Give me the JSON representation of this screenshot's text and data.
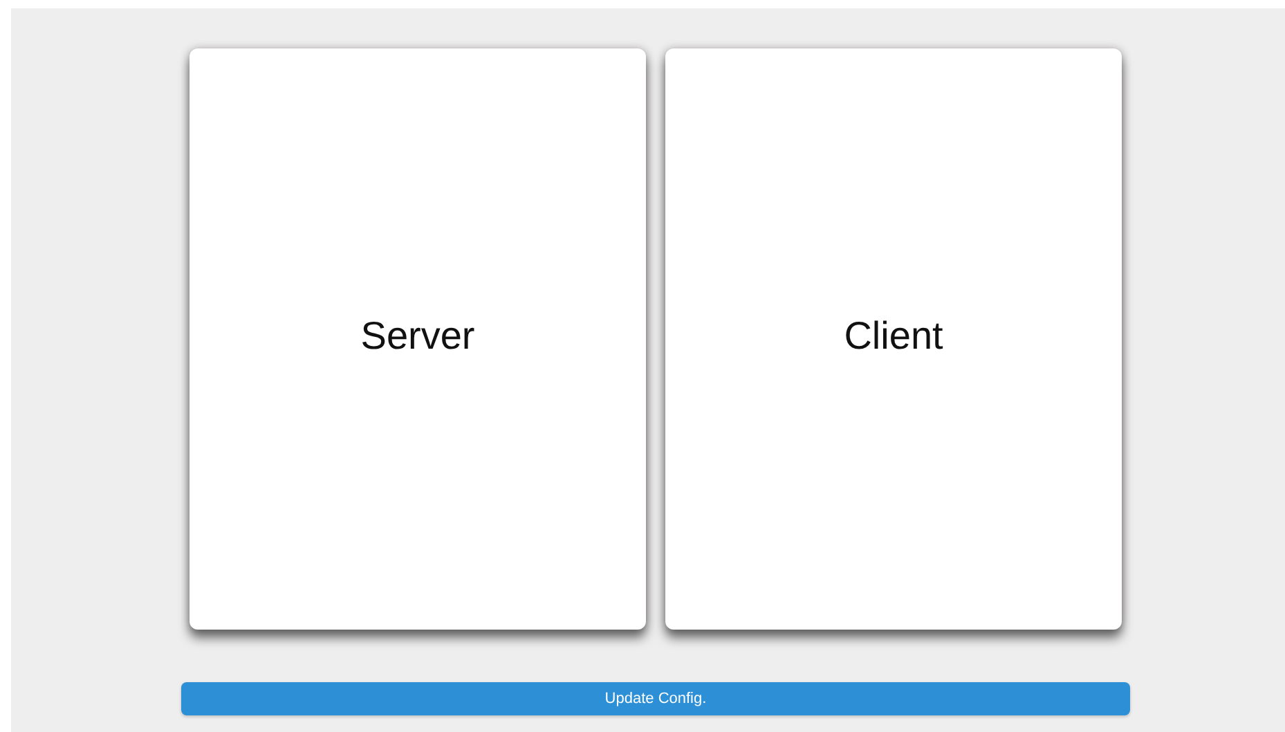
{
  "cards": [
    {
      "label": "Server"
    },
    {
      "label": "Client"
    }
  ],
  "button": {
    "label": "Update Config."
  }
}
